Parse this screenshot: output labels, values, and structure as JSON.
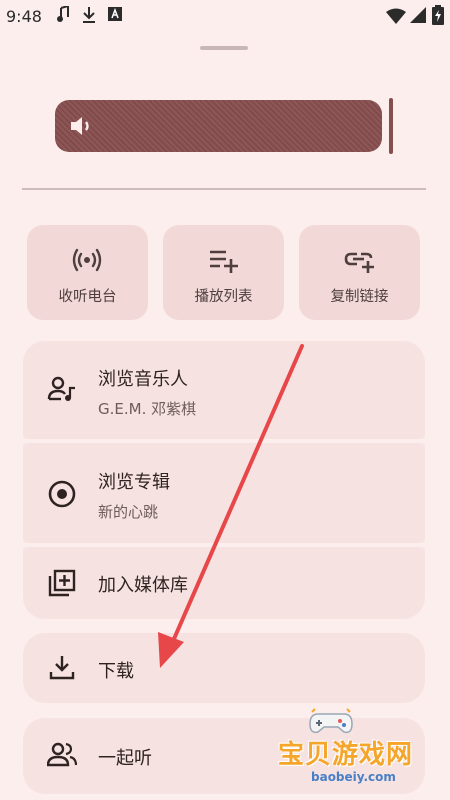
{
  "status": {
    "time": "9:48"
  },
  "volume": {
    "level": 0.96
  },
  "actions": [
    {
      "label": "收听电台",
      "icon": "radio-icon"
    },
    {
      "label": "播放列表",
      "icon": "playlist-add-icon"
    },
    {
      "label": "复制链接",
      "icon": "link-add-icon"
    }
  ],
  "menu": {
    "browse_artist": {
      "title": "浏览音乐人",
      "subtitle": "G.E.M. 邓紫棋"
    },
    "browse_album": {
      "title": "浏览专辑",
      "subtitle": "新的心跳"
    },
    "add_library": {
      "title": "加入媒体库"
    },
    "download": {
      "title": "下载"
    },
    "listen_together": {
      "title": "一起听"
    }
  },
  "watermark": {
    "title": "宝贝游戏网",
    "url": "baobeiy.com"
  },
  "colors": {
    "background": "#fbeeec",
    "accent": "#874e4e",
    "tile": "#f2d9d7",
    "arrow": "#e8474a"
  }
}
